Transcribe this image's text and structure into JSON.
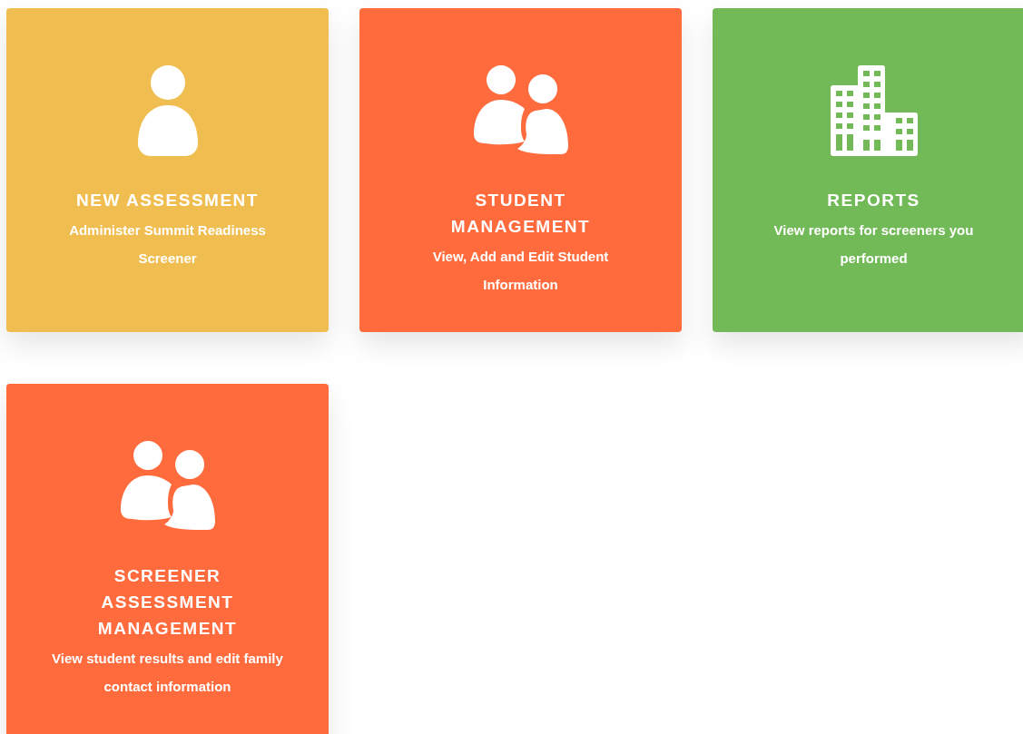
{
  "cards": [
    {
      "kind": "person",
      "color": "#f0be50",
      "title": "NEW ASSESSMENT",
      "description": "Administer Summit Readiness Screener"
    },
    {
      "kind": "people",
      "color": "#ff6b3d",
      "title": "STUDENT MANAGEMENT",
      "description": "View, Add and Edit Student Information"
    },
    {
      "kind": "building",
      "color": "#72b957",
      "title": "REPORTS",
      "description": "View reports for screeners you performed"
    },
    {
      "kind": "people",
      "color": "#ff6b3d",
      "title": "SCREENER ASSESSMENT MANAGEMENT",
      "description": "View student results and edit family contact information"
    }
  ]
}
